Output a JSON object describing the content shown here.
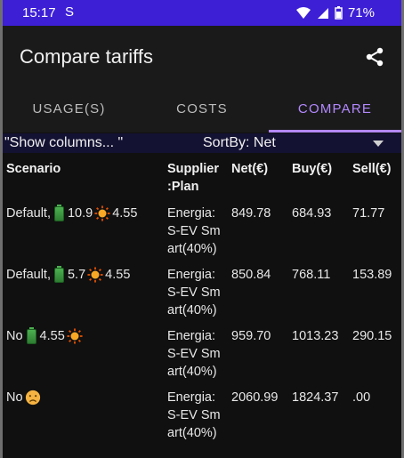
{
  "status": {
    "time": "15:17",
    "s_icon": "S",
    "battery": "71%",
    "icons": [
      "wifi-icon",
      "signal-icon",
      "battery-icon"
    ]
  },
  "appbar": {
    "title": "Compare tariffs",
    "share_icon": "share-icon"
  },
  "tabs": [
    {
      "label": "USAGE(S)",
      "active": false
    },
    {
      "label": "COSTS",
      "active": false
    },
    {
      "label": "COMPARE",
      "active": true
    }
  ],
  "controls": {
    "show_columns": "\"Show columns... \"",
    "sortby": "SortBy: Net"
  },
  "table": {
    "headers": {
      "scenario": "Scenario",
      "supplier": "Supplier\n:Plan",
      "net": "Net(€)",
      "buy": "Buy(€)",
      "sell": "Sell(€)"
    },
    "rows": [
      {
        "prefix": "Default,",
        "battery": "10.9",
        "solar": "4.55",
        "supplier": "Energia:\nS-EV Sm\nart(40%)",
        "net": "849.78",
        "buy": "684.93",
        "sell": "71.77"
      },
      {
        "prefix": "Default,",
        "battery": "5.7",
        "solar": "4.55",
        "supplier": "Energia:\nS-EV Sm\nart(40%)",
        "net": "850.84",
        "buy": "768.11",
        "sell": "153.89"
      },
      {
        "prefix": "No",
        "battery": "4.55",
        "supplier": "Energia:\nS-EV Sm\nart(40%)",
        "net": "959.70",
        "buy": "1013.23",
        "sell": "290.15"
      },
      {
        "prefix": "No",
        "supplier": "Energia:\nS-EV Sm\nart(40%)",
        "net": "2060.99",
        "buy": "1824.37",
        "sell": ".00"
      }
    ]
  },
  "colors": {
    "status_bar": "#3d1fd6",
    "accent": "#b388ff",
    "background": "#101010"
  }
}
